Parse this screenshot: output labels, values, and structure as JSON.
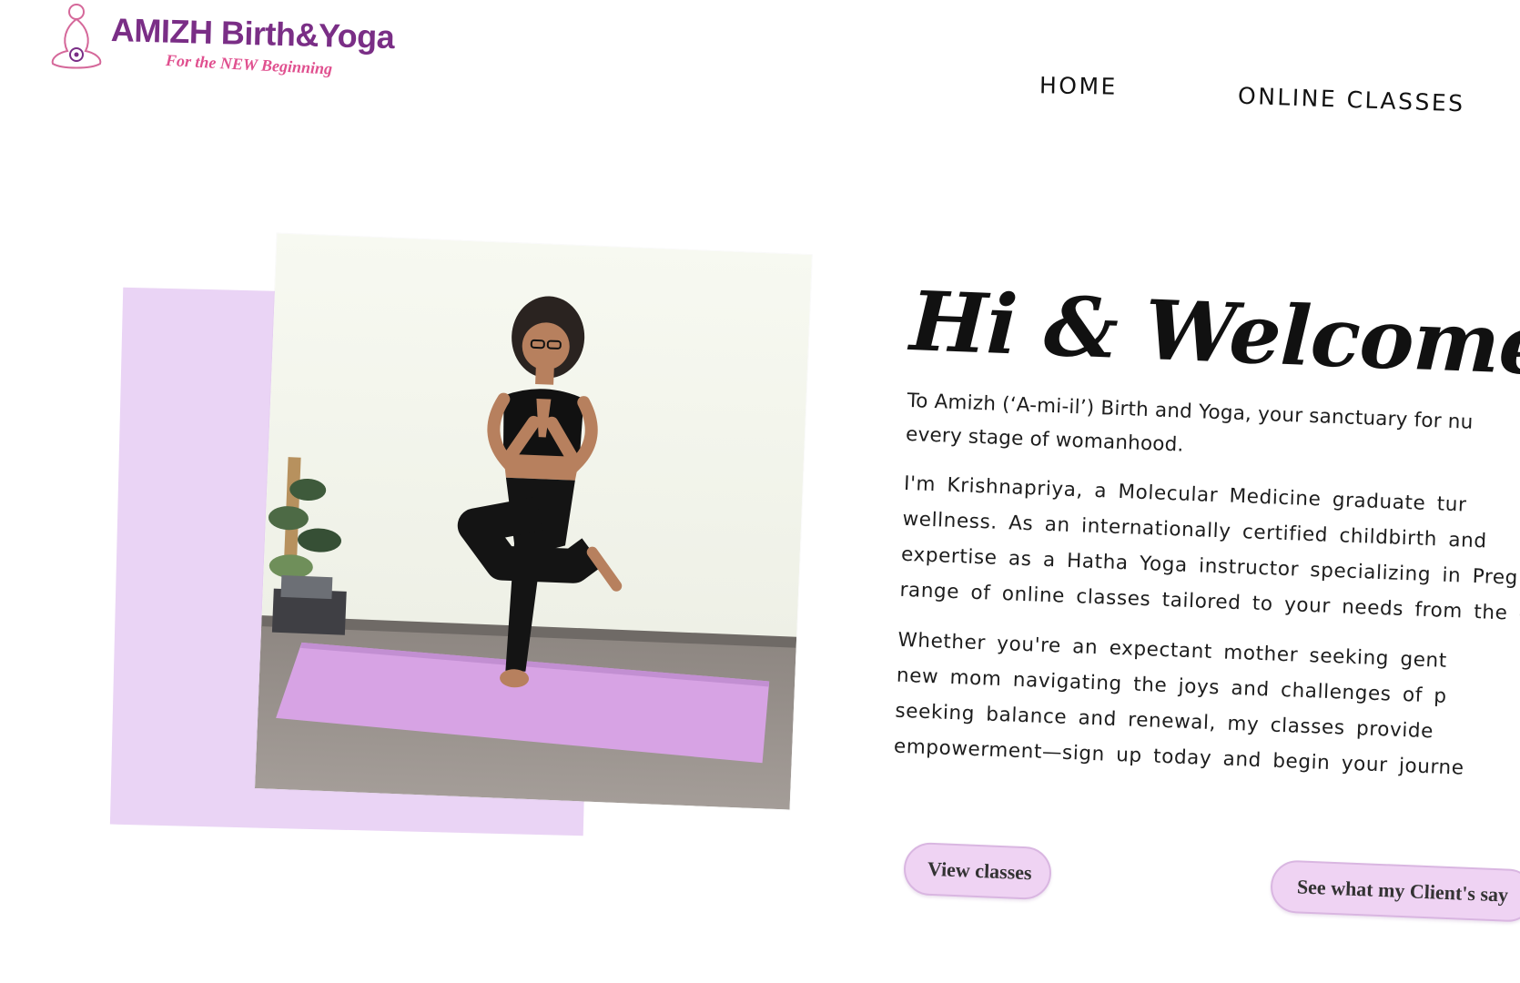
{
  "brand": {
    "name": "AMIZH Birth&Yoga",
    "tagline": "For the NEW Beginning",
    "logo_icon": "meditating-figure-icon",
    "colors": {
      "name": "#7a2e86",
      "tagline": "#e0508f"
    }
  },
  "nav": {
    "items": [
      {
        "label": "HOME"
      },
      {
        "label": "ONLINE CLASSES"
      }
    ]
  },
  "hero": {
    "image_alt": "woman-in-tree-pose-on-lilac-yoga-mat",
    "heading": "Hi & Welcome!",
    "paragraphs": [
      "To Amizh (‘A-mi-il’) Birth and Yoga, your sanctuary for nu\nevery stage of womanhood.",
      "I'm Krishnapriya, a Molecular Medicine graduate tur\nwellness. As an internationally certified childbirth and\nexpertise as a Hatha Yoga instructor specializing in Preg\nrange of online classes tailored to your needs from the c",
      "Whether you're an expectant mother seeking gent\nnew mom navigating the joys and challenges of p\nseeking balance and renewal, my classes provide\nempowerment—sign up today and begin your journe"
    ],
    "buttons": {
      "view_classes": "View classes",
      "clients": "See what my Client's say"
    },
    "colors": {
      "accent": "#ead4f5",
      "button": "#efd3f3"
    }
  }
}
